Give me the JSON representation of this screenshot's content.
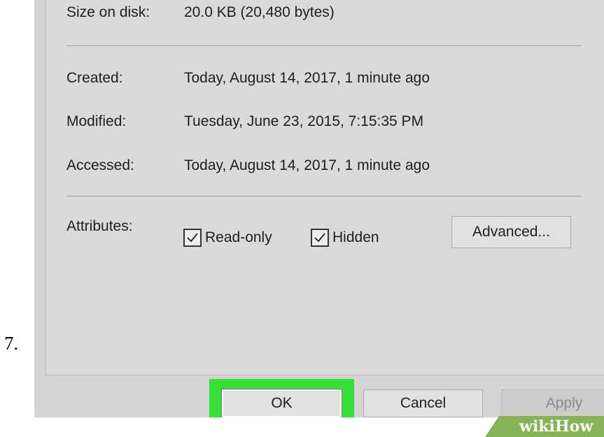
{
  "step": {
    "number": "7."
  },
  "details": {
    "size_on_disk_label": "Size on disk:",
    "size_on_disk_value": "20.0 KB (20,480 bytes)",
    "created_label": "Created:",
    "created_value": "Today, August 14, 2017, 1 minute ago",
    "modified_label": "Modified:",
    "modified_value": "Tuesday, June 23, 2015, 7:15:35 PM",
    "accessed_label": "Accessed:",
    "accessed_value": "Today, August 14, 2017, 1 minute ago"
  },
  "attributes": {
    "label": "Attributes:",
    "read_only": {
      "label": "Read-only",
      "checked": true
    },
    "hidden": {
      "label": "Hidden",
      "checked": true
    },
    "advanced_label": "Advanced..."
  },
  "buttons": {
    "ok_label": "OK",
    "cancel_label": "Cancel",
    "apply_label": "Apply",
    "apply_disabled": true
  },
  "highlight": {
    "target": "ok-button",
    "color": "#37e037"
  },
  "watermark": {
    "text": "wikiHow",
    "color": "#86b356"
  }
}
